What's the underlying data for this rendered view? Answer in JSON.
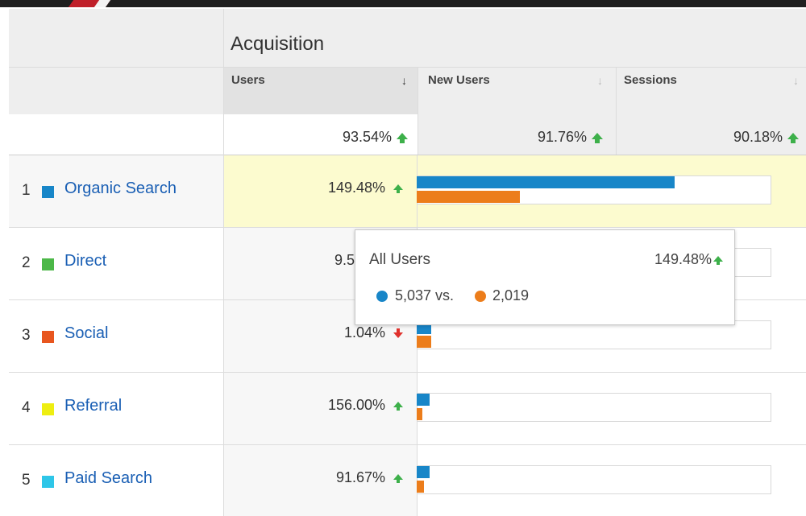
{
  "header": {
    "section_title": "Acquisition",
    "columns": [
      {
        "label": "Users",
        "sorted": true
      },
      {
        "label": "New Users",
        "sorted": false
      },
      {
        "label": "Sessions",
        "sorted": false
      }
    ],
    "totals": [
      "93.54%",
      "91.76%",
      "90.18%"
    ]
  },
  "rows": [
    {
      "rank": "1",
      "channel": "Organic Search",
      "color": "#1886c8",
      "users_change": "149.48%",
      "trend": "up",
      "current": 0.72,
      "previous": 0.285
    },
    {
      "rank": "2",
      "channel": "Direct",
      "color": "#4cb848",
      "users_change": "9.5",
      "trend": "up",
      "current": null,
      "previous": null
    },
    {
      "rank": "3",
      "channel": "Social",
      "color": "#e8561f",
      "users_change": "1.04%",
      "trend": "down",
      "current": 0.04,
      "previous": 0.04
    },
    {
      "rank": "4",
      "channel": "Referral",
      "color": "#eeee11",
      "users_change": "156.00%",
      "trend": "up",
      "current": 0.035,
      "previous": 0.015
    },
    {
      "rank": "5",
      "channel": "Paid Search",
      "color": "#2ec6e8",
      "users_change": "91.67%",
      "trend": "up",
      "current": 0.035,
      "previous": 0.018
    }
  ],
  "tooltip": {
    "title": "All Users",
    "change": "149.48%",
    "current_value": "5,037 vs.",
    "previous_value": "2,019",
    "current_color": "#1886c8",
    "previous_color": "#ec7d1b"
  },
  "colors": {
    "link": "#1a5fb4",
    "up_arrow": "#3db04a",
    "down_arrow": "#e0312c",
    "highlight_row": "#fcfbcf"
  }
}
